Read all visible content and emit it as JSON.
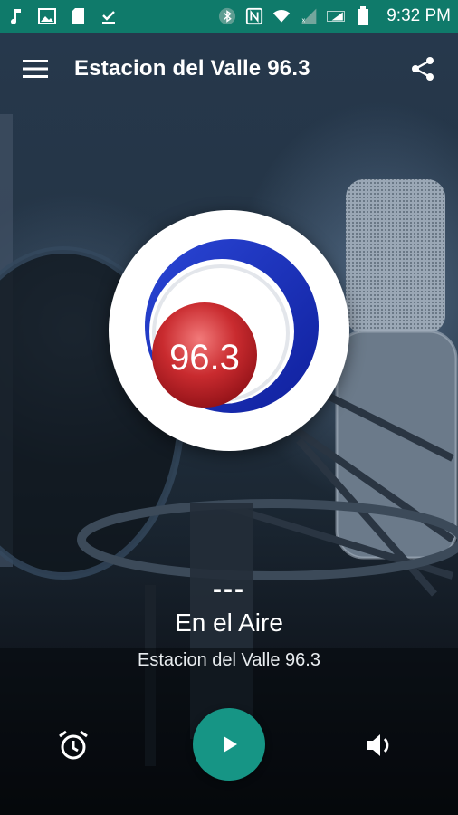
{
  "status_bar": {
    "time": "9:32 PM",
    "left_icons": [
      "music-note-icon",
      "image-icon",
      "sd-card-icon",
      "download-done-icon"
    ],
    "right_icons": [
      "bluetooth-icon",
      "nfc-icon",
      "wifi-icon",
      "signal-icon",
      "signal-icon",
      "battery-icon"
    ],
    "background": "#0f7a6a"
  },
  "app_bar": {
    "title": "Estacion del Valle 96.3",
    "menu_icon": "menu-icon",
    "share_icon": "share-icon"
  },
  "logo": {
    "text": "96.3",
    "colors": {
      "outer_ring": "#1a2fb8",
      "ball": "#c0262c",
      "background": "#ffffff"
    }
  },
  "now_playing": {
    "dashes": "---",
    "title": "En el Aire",
    "station": "Estacion del Valle 96.3"
  },
  "controls": {
    "alarm_icon": "alarm-icon",
    "play_icon": "play-icon",
    "volume_icon": "volume-icon",
    "accent": "#169585"
  }
}
